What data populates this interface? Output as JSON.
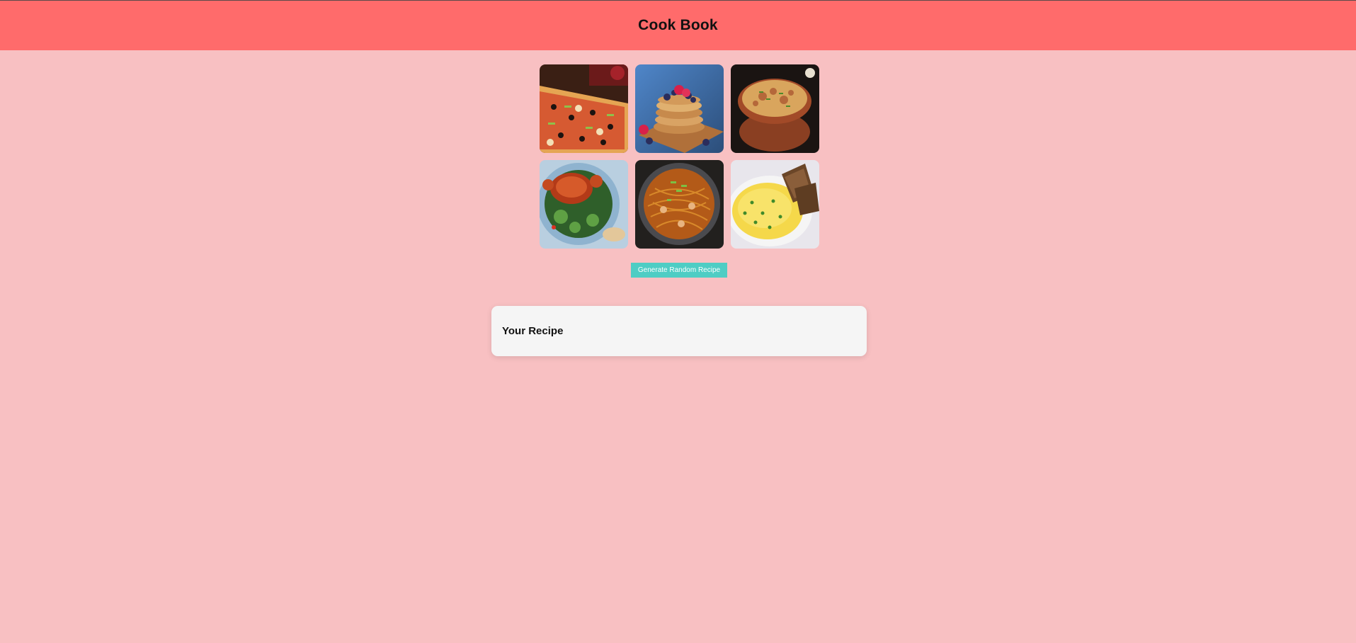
{
  "header": {
    "title": "Cook Book",
    "color": "#ff6b6b"
  },
  "gallery": {
    "images": [
      {
        "name": "pizza-image"
      },
      {
        "name": "pancakes-image"
      },
      {
        "name": "biryani-image"
      },
      {
        "name": "crab-image"
      },
      {
        "name": "noodles-image"
      },
      {
        "name": "omelette-image"
      }
    ]
  },
  "actions": {
    "generate_label": "Generate Random Recipe",
    "button_color": "#4ecdc4"
  },
  "recipe": {
    "title": "Your Recipe"
  },
  "theme": {
    "background": "#f8c0c2"
  }
}
